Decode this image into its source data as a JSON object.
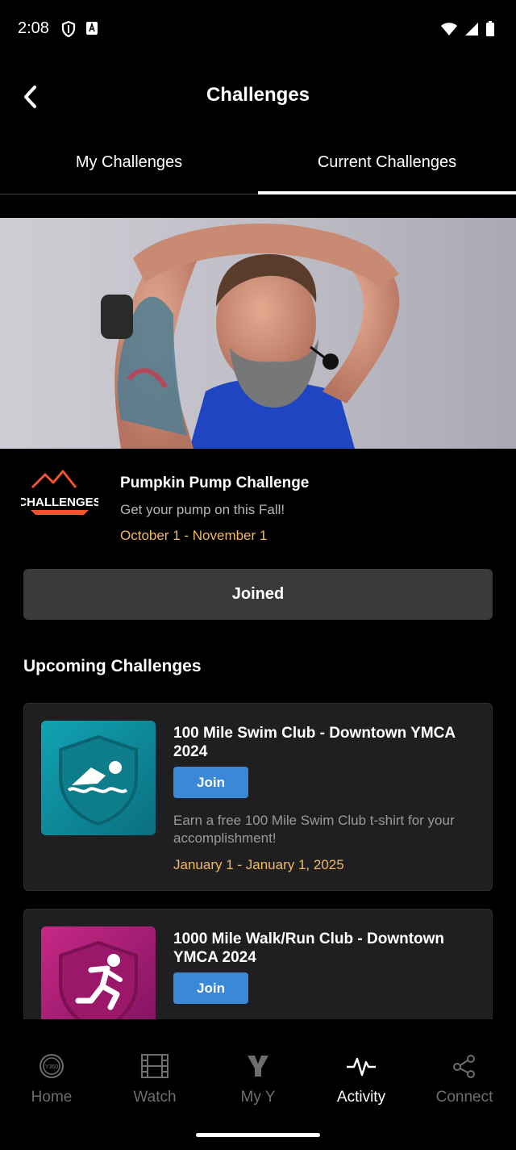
{
  "status_bar": {
    "time": "2:08"
  },
  "header": {
    "title": "Challenges"
  },
  "tabs": [
    {
      "label": "My Challenges",
      "active": false
    },
    {
      "label": "Current Challenges",
      "active": true
    }
  ],
  "featured": {
    "logo_text": "CHALLENGES",
    "title": "Pumpkin Pump Challenge",
    "subtitle": "Get your pump on this Fall!",
    "dates": "October 1 - November 1",
    "button_label": "Joined"
  },
  "upcoming": {
    "section_title": "Upcoming Challenges",
    "items": [
      {
        "title": "100 Mile Swim Club - Downtown YMCA 2024",
        "button_label": "Join",
        "description": "Earn a free 100 Mile Swim Club t-shirt for your accomplishment!",
        "dates": "January 1 - January 1, 2025",
        "icon": "swimmer-icon",
        "color": "#13889a"
      },
      {
        "title": "1000 Mile Walk/Run Club - Downtown YMCA 2024",
        "button_label": "Join",
        "icon": "runner-icon",
        "color": "#a61a73"
      }
    ]
  },
  "bottom_nav": [
    {
      "label": "Home",
      "icon": "y360-icon",
      "active": false
    },
    {
      "label": "Watch",
      "icon": "film-icon",
      "active": false
    },
    {
      "label": "My Y",
      "icon": "y-logo-icon",
      "active": false
    },
    {
      "label": "Activity",
      "icon": "pulse-icon",
      "active": true
    },
    {
      "label": "Connect",
      "icon": "share-network-icon",
      "active": false
    }
  ],
  "colors": {
    "accent_date": "#f2b862",
    "join_button": "#3b88d6",
    "card_bg": "#1f1f21"
  }
}
